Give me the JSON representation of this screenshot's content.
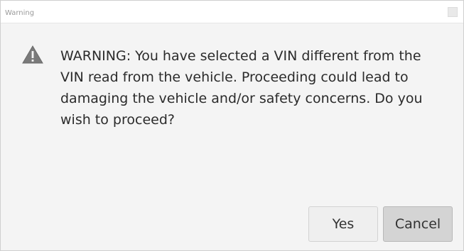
{
  "dialog": {
    "title": "Warning",
    "icon": "warning-triangle-icon",
    "message": "WARNING:  You have selected a VIN different from the\nVIN read from the vehicle.  Proceeding could lead to\ndamaging the vehicle and/or safety concerns.  Do you\nwish to proceed?",
    "buttons": {
      "yes": "Yes",
      "cancel": "Cancel"
    }
  }
}
